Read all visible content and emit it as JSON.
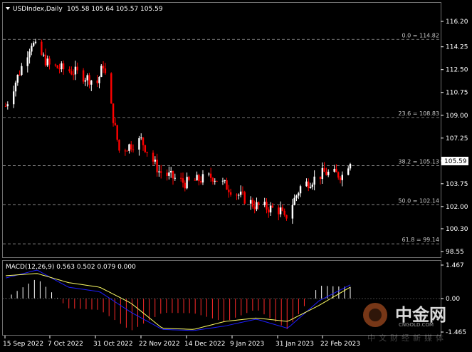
{
  "header": {
    "symbol": "USDIndex,Daily",
    "ohlc": "105.58 105.64 105.57 105.59"
  },
  "macd": {
    "label": "MACD(12,26,9) 0.563 0.502 0.079 0.000",
    "ticks": [
      "1.467",
      "0.00",
      "-1.465"
    ]
  },
  "price_axis": {
    "ticks": [
      "116.20",
      "114.25",
      "112.50",
      "110.75",
      "109.00",
      "107.25",
      "105.50",
      "103.75",
      "102.00",
      "100.30",
      "98.55"
    ],
    "current": "105.59"
  },
  "time_axis": {
    "labels": [
      "15 Sep 2022",
      "7 Oct 2022",
      "31 Oct 2022",
      "22 Nov 2022",
      "14 Dec 2022",
      "9 Jan 2023",
      "31 Jan 2023",
      "22 Feb 2023"
    ]
  },
  "fib_levels": [
    {
      "label": "0.0 = 114.82",
      "value": 114.82
    },
    {
      "label": "23.6 = 108.83",
      "value": 108.83
    },
    {
      "label": "38.2 = 105.13",
      "value": 105.13
    },
    {
      "label": "50.0 = 102.14",
      "value": 102.14
    },
    {
      "label": "61.8 = 99.14",
      "value": 99.14
    }
  ],
  "watermark": {
    "logo": "中金网",
    "sub": "CNGOLD.COM",
    "tagline": "中文财经新媒体"
  },
  "colors": {
    "background": "#000000",
    "bull": "#ffffff",
    "bear": "#ff0000",
    "macd_main": "#0000ff",
    "macd_signal": "#ffff66",
    "grid": "#808080"
  },
  "chart_data": {
    "type": "candlestick",
    "ylim": [
      98.55,
      116.2
    ],
    "close_path": [
      {
        "date": "2022-09-15",
        "close": 109.7
      },
      {
        "date": "2022-09-28",
        "close": 114.6
      },
      {
        "date": "2022-10-07",
        "close": 112.8
      },
      {
        "date": "2022-10-20",
        "close": 112.3
      },
      {
        "date": "2022-10-31",
        "close": 111.5
      },
      {
        "date": "2022-11-03",
        "close": 112.9
      },
      {
        "date": "2022-11-11",
        "close": 106.3
      },
      {
        "date": "2022-11-22",
        "close": 107.1
      },
      {
        "date": "2022-12-01",
        "close": 104.7
      },
      {
        "date": "2022-12-14",
        "close": 103.8
      },
      {
        "date": "2022-12-28",
        "close": 104.3
      },
      {
        "date": "2023-01-09",
        "close": 103.0
      },
      {
        "date": "2023-01-18",
        "close": 102.1
      },
      {
        "date": "2023-01-31",
        "close": 101.7
      },
      {
        "date": "2023-02-02",
        "close": 101.0
      },
      {
        "date": "2023-02-10",
        "close": 103.5
      },
      {
        "date": "2023-02-22",
        "close": 104.6
      },
      {
        "date": "2023-03-03",
        "close": 104.4
      },
      {
        "date": "2023-03-07",
        "close": 105.59
      }
    ],
    "macd_main": [
      0.9,
      1.25,
      0.5,
      0.3,
      -0.6,
      -1.35,
      -1.4,
      -1.2,
      -0.9,
      -1.3,
      -0.1,
      0.6
    ],
    "macd_signal": [
      1.0,
      1.1,
      0.7,
      0.5,
      -0.2,
      -1.3,
      -1.35,
      -1.0,
      -0.85,
      -1.0,
      -0.3,
      0.5
    ]
  }
}
